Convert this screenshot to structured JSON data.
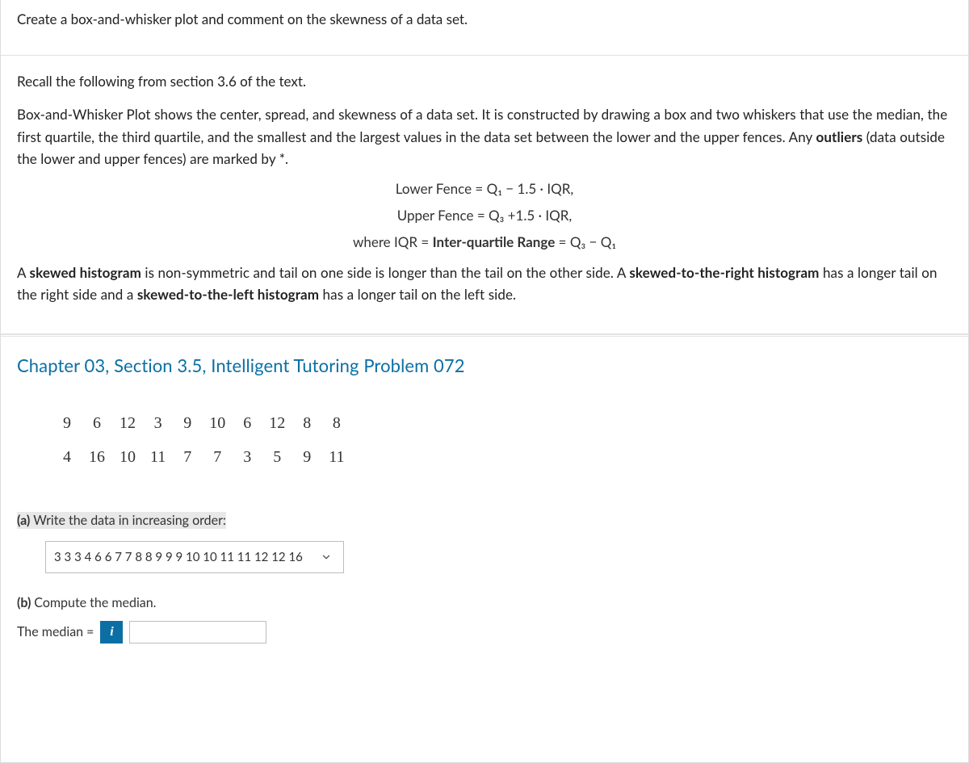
{
  "intro": {
    "prompt": "Create a box-and-whisker plot and comment on the skewness of a data set.",
    "recall": "Recall the following from section 3.6 of the text.",
    "p1_pre": "Box-and-Whisker Plot shows the center, spread, and skewness of a data set. It is constructed by drawing a box and two whiskers that use the median, the first quartile, the third quartile, and the smallest and the largest values in the data set between the lower and the upper fences. Any ",
    "p1_bold": "outliers",
    "p1_post": " (data outside the lower and upper fences) are marked by *.",
    "formula_lower": "Lower Fence = Q₁ − 1.5 · IQR,",
    "formula_upper": "Upper Fence = Q₃ +1.5 · IQR,",
    "formula_iqr_pre": "where IQR = ",
    "formula_iqr_bold": "Inter-quartile Range",
    "formula_iqr_post": " = Q₃ − Q₁",
    "p2_pre": "A ",
    "p2_b1": "skewed histogram",
    "p2_mid1": " is non-symmetric and tail on one side is longer than the tail on the other side. A ",
    "p2_b2": "skewed-to-the-right histogram",
    "p2_mid2": " has a longer tail on the right side and a ",
    "p2_b3": "skewed-to-the-left histogram",
    "p2_post": " has a longer tail on the left side."
  },
  "problem": {
    "chapter_title": "Chapter 03, Section 3.5, Intelligent Tutoring Problem 072",
    "data_row1": [
      "9",
      "6",
      "12",
      "3",
      "9",
      "10",
      "6",
      "12",
      "8",
      "8"
    ],
    "data_row2": [
      "4",
      "16",
      "10",
      "11",
      "7",
      "7",
      "3",
      "5",
      "9",
      "11"
    ],
    "part_a_label_bold": "(a) ",
    "part_a_label_text": "Write the data in increasing order:",
    "sorted_selected": "3 3 3 4 6 6 7 7 8 8 9 9 9 10 10 11 11 12 12 16",
    "part_b_label_bold": "(b) ",
    "part_b_label_text": "Compute the median.",
    "median_label": "The median =",
    "median_value": "",
    "info_glyph": "i"
  }
}
